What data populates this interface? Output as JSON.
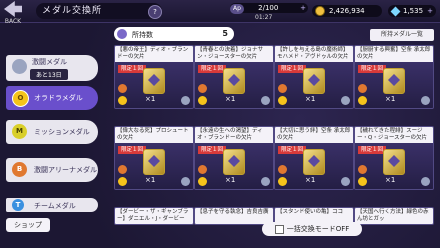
{
  "topbar": {
    "back_label": "BACK",
    "title": "メダル交換所",
    "help": "?",
    "ap_key": "Ap",
    "ap_value": "2/100",
    "ap_timer": "01:27",
    "coins": "2,426,934",
    "gems": "1,535",
    "plus": "+"
  },
  "menu": {
    "gekito": "激闘メダル",
    "gekito_sub": "あと13日",
    "orado": "オラドラメダル",
    "mission": "ミッションメダル",
    "arena": "激闘アリーナメダル",
    "team": "チームメダル",
    "shop": "ショップ",
    "icon_o": "O",
    "icon_m": "M",
    "icon_b": "B",
    "icon_t": "T"
  },
  "panel": {
    "hold_label": "所持数",
    "hold_value": "5",
    "owned_list": "所持メダル一覧",
    "exchange_mode": "一括交換モードOFF"
  },
  "cards": [
    {
      "name": "【悪の帝王】ディオ・ブランドーの欠片",
      "limit": "限定１回",
      "count": "×1"
    },
    {
      "name": "【青春との決着】ジョナサン・ジョースターの欠片",
      "limit": "限定１回",
      "count": "×1"
    },
    {
      "name": "【許しを与える島の魔術師】モハメド・アヴドゥルの欠片",
      "limit": "限定１回",
      "count": "×1"
    },
    {
      "name": "【厨厨する興奮】空条 承太郎の欠片",
      "limit": "限定１回",
      "count": "×1"
    },
    {
      "name": "【偉大なる死】プロシュートの欠片",
      "limit": "限定１回",
      "count": "×1"
    },
    {
      "name": "【永遠の生への渇望】ディオ・ブランドーの欠片",
      "limit": "限定１回",
      "count": "×1"
    },
    {
      "name": "【大切に思う絆】空条 承太郎の欠片",
      "limit": "限定１回",
      "count": "×1"
    },
    {
      "name": "【穢れてきた程緋】スージー・Q・ジョースターの欠片",
      "limit": "限定１回",
      "count": "×1"
    }
  ],
  "bottom_cards": [
    {
      "name": "【ダービー・ザ・ギャンブラー】ダニエル・J・ダービー"
    },
    {
      "name": "【息子を守る執念】吉良吉廣"
    },
    {
      "name": "【スタンド使いの亀】ココ"
    },
    {
      "name": "【天国へ行く方法】緑色の赤ん坊とガッ"
    }
  ]
}
